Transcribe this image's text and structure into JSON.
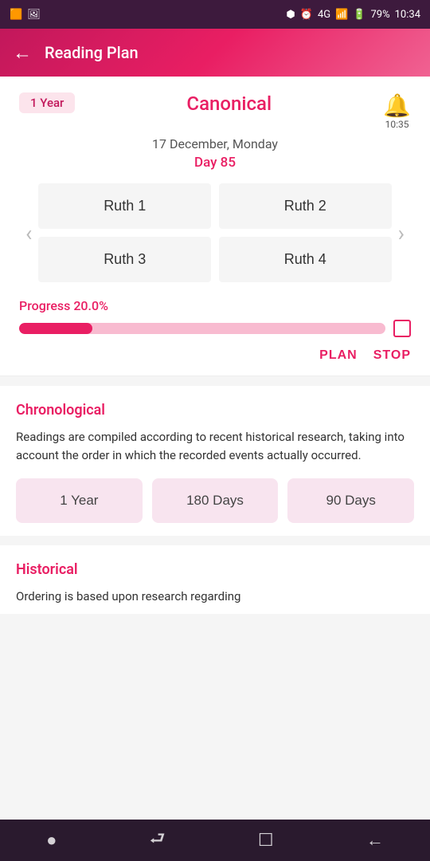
{
  "statusBar": {
    "leftIcons": [
      "🟧",
      "🖼"
    ],
    "rightIcons": [
      "bluetooth",
      "alarm",
      "4G",
      "signal",
      "battery"
    ],
    "battery": "79%",
    "time": "10:34"
  },
  "appBar": {
    "title": "Reading Plan",
    "backArrow": "←"
  },
  "canonical": {
    "yearBadge": "1 Year",
    "title": "Canonical",
    "date": "17 December, Monday",
    "day": "Day 85",
    "bellTime": "10:35",
    "chapters": [
      "Ruth 1",
      "Ruth 2",
      "Ruth 3",
      "Ruth 4"
    ],
    "progressLabel": "Progress 20.0%",
    "progressPercent": 20,
    "planBtn": "PLAN",
    "stopBtn": "STOP"
  },
  "chronological": {
    "title": "Chronological",
    "description": "Readings are compiled according to recent historical research, taking into account the order in which the recorded events actually occurred.",
    "durations": [
      "1 Year",
      "180 Days",
      "90 Days"
    ]
  },
  "historical": {
    "title": "Historical",
    "description": "Ordering is based upon research regarding"
  },
  "bottomNav": {
    "icons": [
      "●",
      "⮐",
      "☐",
      "←"
    ]
  }
}
